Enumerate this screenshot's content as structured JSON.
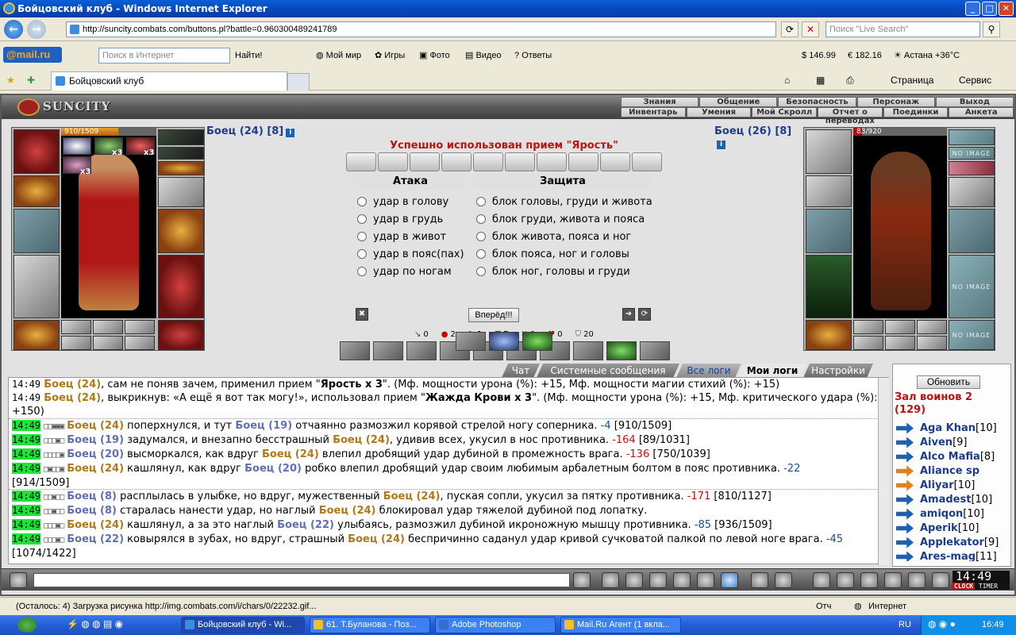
{
  "window": {
    "title": "Бойцовский клуб - Windows Internet Explorer"
  },
  "address": {
    "url": "http://suncity.combats.com/buttons.pl?battle=0.960300489241789",
    "search_placeholder": "Поиск \"Live Search\""
  },
  "mailru": {
    "logo_a": "@mail",
    "logo_b": ".ru",
    "search_placeholder": "Поиск в Интернет",
    "find": "Найти!",
    "mymir": "Мой мир",
    "games": "Игры",
    "photo": "Фото",
    "video": "Видео",
    "answers": "Ответы",
    "money": "146.99",
    "euro": "182.16",
    "weather": "Астана +36°C"
  },
  "tab": {
    "title": "Бойцовский клуб",
    "page": "Страница",
    "service": "Сервис"
  },
  "game": {
    "logo": "SUNCITY",
    "menu_top": [
      "Знания",
      "Общение",
      "Безопасность",
      "Персонаж",
      "Выход"
    ],
    "menu_bottom": [
      "Инвентарь",
      "Умения",
      "Мой Скролл",
      "Отчет о переводах",
      "Поединки",
      "Анкета"
    ],
    "left_hp": "910/1509",
    "left_hp_fraction": 0.603,
    "right_hp": "83/920",
    "right_hp_fraction": 0.09,
    "left_name": "Боец (24) [8]",
    "right_name": "Боец (26) [8]",
    "info": "i",
    "x3": "x3",
    "noimage": "NO IMAGE",
    "message": "Успешно использован прием \"Ярость\"",
    "attack_head": "Атака",
    "defense_head": "Защита",
    "attacks": [
      "удар в голову",
      "удар в грудь",
      "удар в живот",
      "удар в пояс(пах)",
      "удар по ногам"
    ],
    "defenses": [
      "блок головы, груди и живота",
      "блок груди, живота и пояса",
      "блок живота, пояса и ног",
      "блок пояса, ног и головы",
      "блок ног, головы и груди"
    ],
    "go": "Вперёд!!!",
    "stats": [
      "0",
      "2",
      "1",
      "7",
      "0",
      "0",
      "20"
    ],
    "log_tabs": [
      "Чат",
      "Системные сообщения",
      "Все логи",
      "Мои логи",
      "Настройки"
    ],
    "refresh": "Обновить",
    "hall": "Зал воинов 2 (129)",
    "warriors": [
      {
        "name": "Aga Khan",
        "lv": "[10]"
      },
      {
        "name": "Aiven",
        "lv": "[9]"
      },
      {
        "name": "Alco Mafia",
        "lv": "[8]"
      },
      {
        "name": "Aliance sp",
        "lv": ""
      },
      {
        "name": "Aliyar",
        "lv": "[10]"
      },
      {
        "name": "Amadest",
        "lv": "[10]"
      },
      {
        "name": "amiqon",
        "lv": "[10]"
      },
      {
        "name": "Aperik",
        "lv": "[10]"
      },
      {
        "name": "Applekator",
        "lv": "[9]"
      },
      {
        "name": "Ares-mag",
        "lv": "[11]"
      }
    ],
    "clock": "14:49",
    "clock_lbl_a": "CLOCK",
    "clock_lbl_b": "TIMER"
  },
  "log": {
    "l1_t": "14:49",
    "l1_p": "Боец (24)",
    "l1_a": ", сам не поняв зачем, применил прием \"",
    "l1_b": "Ярость x 3",
    "l1_c": "\". (Мф. мощности урона (%): +15, Мф. мощности магии стихий (%): +15)",
    "l2_t": "14:49",
    "l2_p": "Боец (24)",
    "l2_a": ", выкрикнув: «А ещё я вот так могу!», использовал прием \"",
    "l2_b": "Жажда Крови x 3",
    "l2_c": "\". (Мф. мощности урона (%): +15, Мф. критического удара (%): +150)",
    "l3_t": "14:49",
    "l3_bx": "□□▣▣▣",
    "l3_p1": "Боец (24)",
    "l3_a": " поперхнулся, и тут ",
    "l3_p2": "Боец (19)",
    "l3_b": " отчаянно размозжил корявой стрелой ногу соперника. ",
    "l3_d": "-4",
    "l3_h": " [910/1509]",
    "l4_t": "14:49",
    "l4_bx": "□□□▣□",
    "l4_p1": "Боец (19)",
    "l4_a": " задумался, и внезапно бесстрашный ",
    "l4_p2": "Боец (24)",
    "l4_b": ", удивив всех, укусил в нос противника. ",
    "l4_d": "-164",
    "l4_h": " [89/1031]",
    "l5_t": "14:49",
    "l5_bx": "□□□□▣",
    "l5_p1": "Боец (20)",
    "l5_a": " высморкался, как вдруг ",
    "l5_p2": "Боец (24)",
    "l5_b": " влепил дробящий удар дубиной в промежность врага. ",
    "l5_d": "-136",
    "l5_h": " [750/1039]",
    "l6_t": "14:49",
    "l6_bx": "□▣□□▣",
    "l6_p1": "Боец (24)",
    "l6_a": " кашлянул, как вдруг ",
    "l6_p2": "Боец (20)",
    "l6_b": " робко влепил дробящий удар своим любимым арбалетным болтом в пояс противника. ",
    "l6_d": "-22",
    "l6_h": "[914/1509]",
    "l7_t": "14:49",
    "l7_bx": "□□▣□□",
    "l7_p1": "Боец (8)",
    "l7_a": " расплылась в улыбке, но вдруг, мужественный ",
    "l7_p2": "Боец (24)",
    "l7_b": ", пуская сопли, укусил за пятку противника. ",
    "l7_d": "-171",
    "l7_h": " [810/1127]",
    "l8_t": "14:49",
    "l8_bx": "□□▣□□",
    "l8_p1": "Боец (8)",
    "l8_a": " старалась нанести удар, но наглый ",
    "l8_p2": "Боец (24)",
    "l8_b": " блокировал удар тяжелой дубиной под лопатку.",
    "l9_t": "14:49",
    "l9_bx": "□□□▣□",
    "l9_p1": "Боец (24)",
    "l9_a": " кашлянул, а за это наглый ",
    "l9_p2": "Боец (22)",
    "l9_b": " улыбаясь, размозжил дубиной икроножную мышцу противника. ",
    "l9_d": "-85",
    "l9_h": " [936/1509]",
    "l10_t": "14:49",
    "l10_bx": "□□□▣□",
    "l10_p1": "Боец (22)",
    "l10_a": " ковырялся в зубах, но вдруг, страшный ",
    "l10_p2": "Боец (24)",
    "l10_b": " беспричинно саданул удар кривой сучковатой палкой по левой ноге врага. ",
    "l10_d": "-45",
    "l10_h": "[1074/1422]"
  },
  "status": {
    "text": "(Осталось: 4) Загрузка рисунка http://img.combats.com/i/chars/0/22232.gif...",
    "zone": "Интернет",
    "otch": "Отч"
  },
  "taskbar": {
    "items": [
      "Бойцовский клуб - Wi...",
      "61. Т.Буланова - Поз...",
      "Adobe Photoshop",
      "Mail.Ru Агент (1 вкла..."
    ],
    "lang": "RU",
    "time": "16:49"
  }
}
